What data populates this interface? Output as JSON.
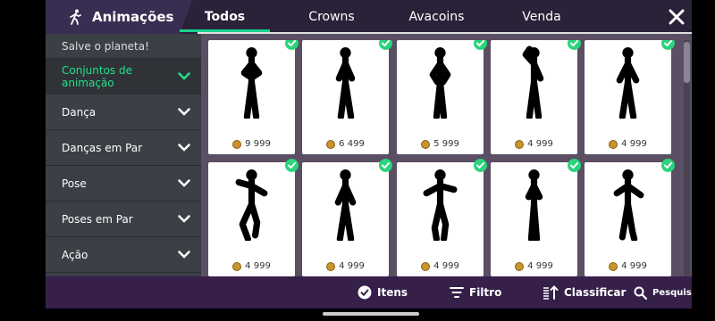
{
  "header": {
    "title": "Animações",
    "tabs": [
      "Todos",
      "Crowns",
      "Avacoins",
      "Venda"
    ]
  },
  "sidebar": {
    "items": [
      {
        "label": "Salve o planeta!"
      },
      {
        "label": "Conjuntos de animação"
      },
      {
        "label": "Dança"
      },
      {
        "label": "Danças em Par"
      },
      {
        "label": "Pose"
      },
      {
        "label": "Poses em Par"
      },
      {
        "label": "Ação"
      }
    ]
  },
  "grid": {
    "items": [
      {
        "price": "9 999"
      },
      {
        "price": "6 499"
      },
      {
        "price": "5 999"
      },
      {
        "price": "4 999"
      },
      {
        "price": "4 999"
      },
      {
        "price": "4 999"
      },
      {
        "price": "4 999"
      },
      {
        "price": "4 999"
      },
      {
        "price": "4 999"
      },
      {
        "price": "4 999"
      }
    ]
  },
  "bottombar": {
    "itens": "Itens",
    "filtro": "Filtro",
    "classificar": "Classificar",
    "pesquisa": "Pesquisa"
  },
  "colors": {
    "accent": "#19d490",
    "header_bg": "#2a2238",
    "bottom_bg": "#36204a",
    "check": "#2bd47d"
  }
}
